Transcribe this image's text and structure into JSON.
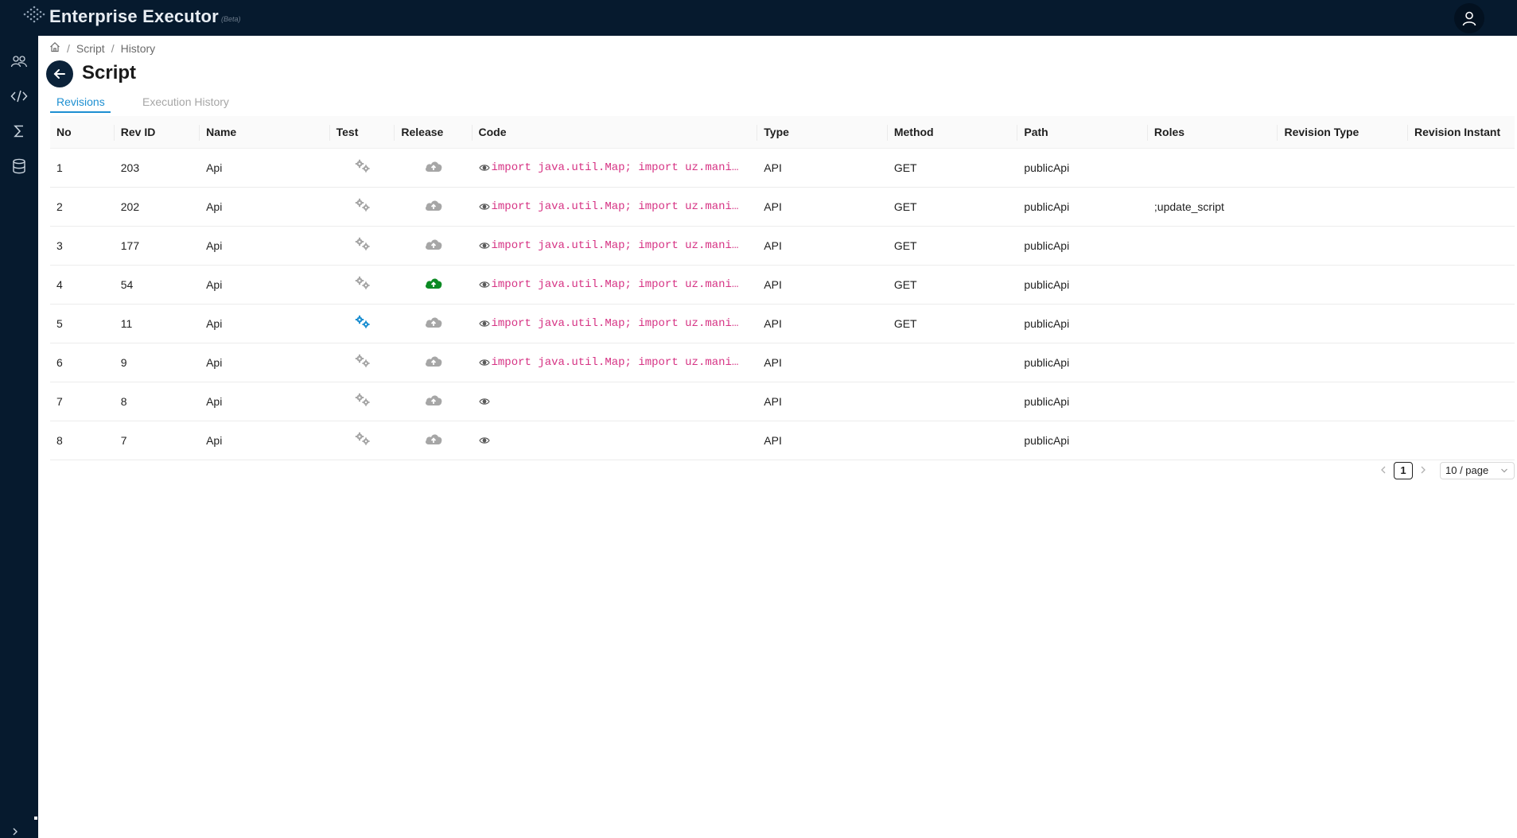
{
  "app": {
    "title": "Enterprise Executor",
    "badge": "(Beta)"
  },
  "sidebar": {
    "items": [
      {
        "icon": "users-icon"
      },
      {
        "icon": "code-icon"
      },
      {
        "icon": "sigma-icon"
      },
      {
        "icon": "database-icon"
      }
    ],
    "expand_icon": "chevron-right-icon"
  },
  "breadcrumb": {
    "home_icon": "home-icon",
    "items": [
      "Script",
      "History"
    ]
  },
  "page": {
    "title": "Script"
  },
  "tabs": [
    {
      "label": "Revisions",
      "active": true
    },
    {
      "label": "Execution History",
      "active": false
    }
  ],
  "table": {
    "columns": [
      "No",
      "Rev ID",
      "Name",
      "Test",
      "Release",
      "Code",
      "Type",
      "Method",
      "Path",
      "Roles",
      "Revision Type",
      "Revision Instant"
    ],
    "rows": [
      {
        "no": "1",
        "rev_id": "203",
        "name": "Api",
        "test_active": false,
        "release_active": false,
        "code": "import java.util.Map; import uz.mani…",
        "type": "API",
        "method": "GET",
        "path": "publicApi",
        "roles": "",
        "revision_type": "",
        "revision_instant": ""
      },
      {
        "no": "2",
        "rev_id": "202",
        "name": "Api",
        "test_active": false,
        "release_active": false,
        "code": "import java.util.Map; import uz.mani…",
        "type": "API",
        "method": "GET",
        "path": "publicApi",
        "roles": ";update_script",
        "revision_type": "",
        "revision_instant": ""
      },
      {
        "no": "3",
        "rev_id": "177",
        "name": "Api",
        "test_active": false,
        "release_active": false,
        "code": "import java.util.Map; import uz.mani…",
        "type": "API",
        "method": "GET",
        "path": "publicApi",
        "roles": "",
        "revision_type": "",
        "revision_instant": ""
      },
      {
        "no": "4",
        "rev_id": "54",
        "name": "Api",
        "test_active": false,
        "release_active": true,
        "code": "import java.util.Map; import uz.mani…",
        "type": "API",
        "method": "GET",
        "path": "publicApi",
        "roles": "",
        "revision_type": "",
        "revision_instant": ""
      },
      {
        "no": "5",
        "rev_id": "11",
        "name": "Api",
        "test_active": true,
        "release_active": false,
        "code": "import java.util.Map; import uz.mani…",
        "type": "API",
        "method": "GET",
        "path": "publicApi",
        "roles": "",
        "revision_type": "",
        "revision_instant": ""
      },
      {
        "no": "6",
        "rev_id": "9",
        "name": "Api",
        "test_active": false,
        "release_active": false,
        "code": "import java.util.Map; import uz.mani…",
        "type": "API",
        "method": "",
        "path": "publicApi",
        "roles": "",
        "revision_type": "",
        "revision_instant": ""
      },
      {
        "no": "7",
        "rev_id": "8",
        "name": "Api",
        "test_active": false,
        "release_active": false,
        "code": "",
        "type": "API",
        "method": "",
        "path": "publicApi",
        "roles": "",
        "revision_type": "",
        "revision_instant": ""
      },
      {
        "no": "8",
        "rev_id": "7",
        "name": "Api",
        "test_active": false,
        "release_active": false,
        "code": "",
        "type": "API",
        "method": "",
        "path": "publicApi",
        "roles": "",
        "revision_type": "",
        "revision_instant": ""
      }
    ]
  },
  "pagination": {
    "current_page": "1",
    "page_size": "10 / page"
  },
  "colors": {
    "nav_background": "#061a2e",
    "accent": "#1d8fd1",
    "release_active": "#0b8a23",
    "test_active": "#1d8fd1",
    "icon_inactive": "#a6a6a6",
    "code_text": "#d63384"
  }
}
